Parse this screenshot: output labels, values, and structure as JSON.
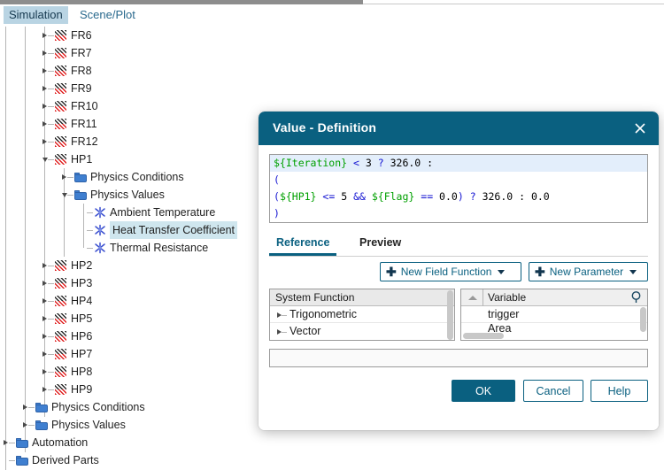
{
  "app": {
    "tabs": [
      {
        "label": "Simulation",
        "active": true
      },
      {
        "label": "Scene/Plot",
        "active": false
      }
    ]
  },
  "tree": {
    "rows": [
      {
        "label": "FR6",
        "depth": 3,
        "icon": "part-hatched-icon",
        "twisty": "right",
        "selected": false
      },
      {
        "label": "FR7",
        "depth": 3,
        "icon": "part-hatched-icon",
        "twisty": "right",
        "selected": false
      },
      {
        "label": "FR8",
        "depth": 3,
        "icon": "part-hatched-icon",
        "twisty": "right",
        "selected": false
      },
      {
        "label": "FR9",
        "depth": 3,
        "icon": "part-hatched-icon",
        "twisty": "right",
        "selected": false
      },
      {
        "label": "FR10",
        "depth": 3,
        "icon": "part-hatched-icon",
        "twisty": "right",
        "selected": false
      },
      {
        "label": "FR11",
        "depth": 3,
        "icon": "part-hatched-icon",
        "twisty": "right",
        "selected": false
      },
      {
        "label": "FR12",
        "depth": 3,
        "icon": "part-hatched-icon",
        "twisty": "right",
        "selected": false
      },
      {
        "label": "HP1",
        "depth": 3,
        "icon": "part-hatched-icon",
        "twisty": "down",
        "selected": false
      },
      {
        "label": "Physics Conditions",
        "depth": 4,
        "icon": "folder-icon",
        "twisty": "right",
        "selected": false
      },
      {
        "label": "Physics Values",
        "depth": 4,
        "icon": "folder-icon",
        "twisty": "down",
        "selected": false
      },
      {
        "label": "Ambient Temperature",
        "depth": 5,
        "icon": "field-function-icon",
        "twisty": "none",
        "selected": false
      },
      {
        "label": "Heat Transfer Coefficient",
        "depth": 5,
        "icon": "field-function-icon",
        "twisty": "none",
        "selected": true
      },
      {
        "label": "Thermal Resistance",
        "depth": 5,
        "icon": "field-function-icon",
        "twisty": "none",
        "selected": false
      },
      {
        "label": "HP2",
        "depth": 3,
        "icon": "part-hatched-icon",
        "twisty": "right",
        "selected": false
      },
      {
        "label": "HP3",
        "depth": 3,
        "icon": "part-hatched-icon",
        "twisty": "right",
        "selected": false
      },
      {
        "label": "HP4",
        "depth": 3,
        "icon": "part-hatched-icon",
        "twisty": "right",
        "selected": false
      },
      {
        "label": "HP5",
        "depth": 3,
        "icon": "part-hatched-icon",
        "twisty": "right",
        "selected": false
      },
      {
        "label": "HP6",
        "depth": 3,
        "icon": "part-hatched-icon",
        "twisty": "right",
        "selected": false
      },
      {
        "label": "HP7",
        "depth": 3,
        "icon": "part-hatched-icon",
        "twisty": "right",
        "selected": false
      },
      {
        "label": "HP8",
        "depth": 3,
        "icon": "part-hatched-icon",
        "twisty": "right",
        "selected": false
      },
      {
        "label": "HP9",
        "depth": 3,
        "icon": "part-hatched-icon",
        "twisty": "right",
        "selected": false
      },
      {
        "label": "Physics Conditions",
        "depth": 2,
        "icon": "folder-icon",
        "twisty": "right",
        "selected": false
      },
      {
        "label": "Physics Values",
        "depth": 2,
        "icon": "folder-icon",
        "twisty": "right",
        "selected": false
      },
      {
        "label": "Automation",
        "depth": 1,
        "icon": "folder-icon",
        "twisty": "right",
        "selected": false
      },
      {
        "label": "Derived Parts",
        "depth": 1,
        "icon": "folder-icon",
        "twisty": "none",
        "selected": false
      }
    ]
  },
  "dialog": {
    "title": "Value - Definition",
    "close_label": "✕",
    "code_lines": [
      {
        "highlight": true,
        "tokens": [
          {
            "t": "${Iteration}",
            "c": "g"
          },
          {
            "t": " ",
            "c": "k"
          },
          {
            "t": "<",
            "c": "b"
          },
          {
            "t": " 3 ",
            "c": "k"
          },
          {
            "t": "?",
            "c": "b"
          },
          {
            "t": " 326.0 :",
            "c": "k"
          }
        ]
      },
      {
        "highlight": false,
        "tokens": [
          {
            "t": "(",
            "c": "b"
          }
        ]
      },
      {
        "highlight": false,
        "tokens": [
          {
            "t": "(",
            "c": "b"
          },
          {
            "t": "${HP1}",
            "c": "g"
          },
          {
            "t": " ",
            "c": "k"
          },
          {
            "t": "<=",
            "c": "b"
          },
          {
            "t": " 5 ",
            "c": "k"
          },
          {
            "t": "&&",
            "c": "b"
          },
          {
            "t": " ",
            "c": "k"
          },
          {
            "t": "${Flag}",
            "c": "g"
          },
          {
            "t": " ",
            "c": "k"
          },
          {
            "t": "==",
            "c": "b"
          },
          {
            "t": " 0.0",
            "c": "k"
          },
          {
            "t": ")",
            "c": "b"
          },
          {
            "t": " ",
            "c": "k"
          },
          {
            "t": "?",
            "c": "b"
          },
          {
            "t": " 326.0 : 0.0",
            "c": "k"
          }
        ]
      },
      {
        "highlight": false,
        "tokens": [
          {
            "t": ")",
            "c": "b"
          }
        ]
      }
    ],
    "code_plain": "${Iteration} < 3 ? 326.0 :\n(\n(${HP1} <= 5 && ${Flag} == 0.0) ? 326.0 : 0.0\n)",
    "tabs": [
      {
        "label": "Reference",
        "active": true
      },
      {
        "label": "Preview",
        "active": false
      }
    ],
    "toolbar": {
      "new_field_function": "New Field Function",
      "new_parameter": "New Parameter",
      "plus_glyph": "✚"
    },
    "system_function_panel": {
      "header": "System Function",
      "items": [
        "Trigonometric",
        "Vector"
      ]
    },
    "variable_panel": {
      "header": "Variable",
      "search_glyph": "⌕",
      "items": [
        "trigger",
        "Area"
      ]
    },
    "expression_input": {
      "value": "",
      "placeholder": ""
    },
    "buttons": {
      "ok": "OK",
      "cancel": "Cancel",
      "help": "Help"
    }
  },
  "colors": {
    "accent": "#0a6080",
    "tab_active_bg": "#b9d4e3",
    "tree_selection": "#cfe6ee",
    "code_token_function": "#00a000",
    "code_token_operator": "#1414d2",
    "code_current_line": "#e3eefb"
  }
}
